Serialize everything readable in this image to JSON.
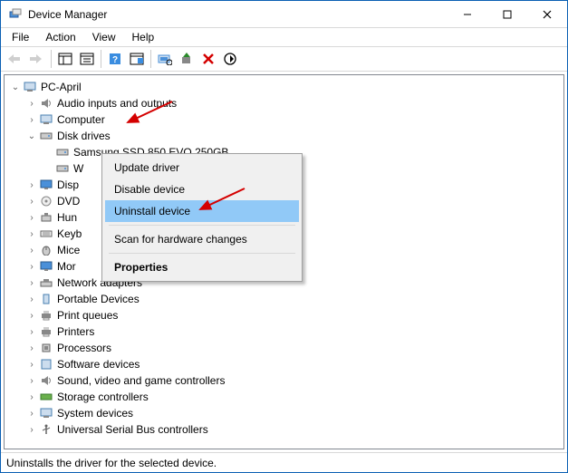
{
  "window": {
    "title": "Device Manager"
  },
  "menu": {
    "file": "File",
    "action": "Action",
    "view": "View",
    "help": "Help"
  },
  "tree": {
    "root": "PC-April",
    "audio": "Audio inputs and outputs",
    "computer": "Computer",
    "diskdrives": "Disk drives",
    "ssd": "Samsung SSD 850 EVO 250GB",
    "wd_partial": "W",
    "display": "Disp",
    "dvd": "DVD",
    "hid": "Hun",
    "keyb": "Keyb",
    "mice": "Mice",
    "mon": "Mor",
    "netadapt": "Network adapters",
    "portable": "Portable Devices",
    "printq": "Print queues",
    "printers": "Printers",
    "processors": "Processors",
    "software": "Software devices",
    "sound": "Sound, video and game controllers",
    "storage": "Storage controllers",
    "system": "System devices",
    "usb": "Universal Serial Bus controllers"
  },
  "context_menu": {
    "update": "Update driver",
    "disable": "Disable device",
    "uninstall": "Uninstall device",
    "scan": "Scan for hardware changes",
    "properties": "Properties"
  },
  "statusbar": "Uninstalls the driver for the selected device."
}
